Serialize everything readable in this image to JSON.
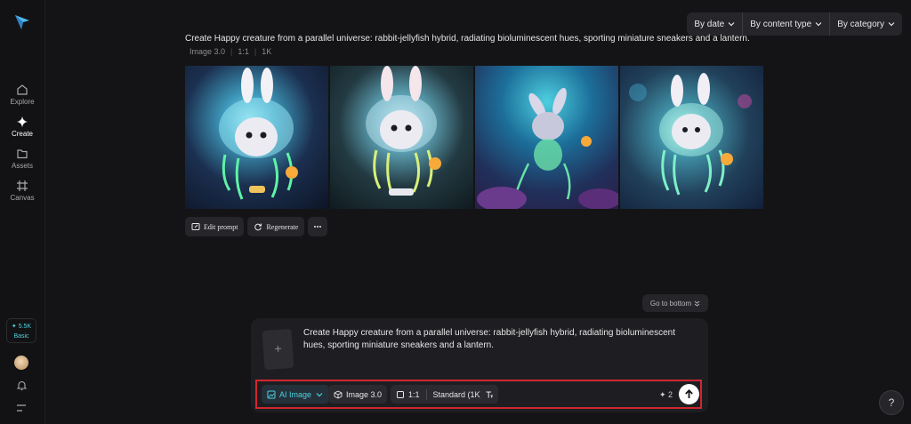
{
  "nav": {
    "items": [
      {
        "label": "Explore",
        "icon": "home-icon"
      },
      {
        "label": "Create",
        "icon": "sparkle-icon"
      },
      {
        "label": "Assets",
        "icon": "folder-icon"
      },
      {
        "label": "Canvas",
        "icon": "frame-icon"
      }
    ],
    "credits": {
      "amount": "5.5K",
      "plan": "Basic"
    }
  },
  "filters": {
    "by_date": "By date",
    "by_content_type": "By content type",
    "by_category": "By category"
  },
  "generation": {
    "prompt": "Create Happy creature from a parallel universe: rabbit-jellyfish hybrid, radiating bioluminescent hues, sporting miniature sneakers and a lantern.",
    "model": "Image 3.0",
    "ratio": "1:1",
    "resolution": "1K"
  },
  "actions": {
    "edit_prompt": "Edit prompt",
    "regenerate": "Regenerate"
  },
  "go_to_bottom": "Go to bottom",
  "composer": {
    "text": "Create Happy creature from a parallel universe: rabbit-jellyfish hybrid, radiating bioluminescent hues, sporting miniature sneakers and a lantern.",
    "mode": "AI Image",
    "model": "Image 3.0",
    "ratio": "1:1",
    "quality": "Standard (1K)",
    "cost": "2"
  },
  "colors": {
    "accent": "#4fd1dd",
    "highlight_box": "#d1262f",
    "background": "#141416"
  }
}
